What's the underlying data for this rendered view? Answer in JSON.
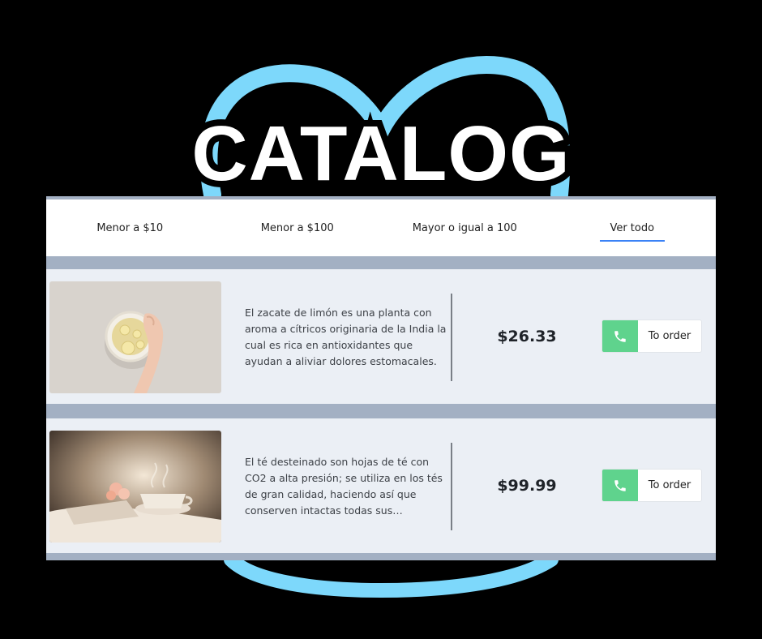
{
  "banner": {
    "title": "CATALOG"
  },
  "filters": [
    {
      "label": "Menor a $10",
      "active": false
    },
    {
      "label": "Menor a $100",
      "active": false
    },
    {
      "label": "Mayor o igual a 100",
      "active": false
    },
    {
      "label": "Ver todo",
      "active": true
    }
  ],
  "products": [
    {
      "image": "lemon-tea-photo",
      "description": "El zacate de limón es una planta con aroma a cítricos originaria de la India la cual es rica en antioxidantes que ayudan a aliviar dolores estomacales.",
      "price": "$26.33",
      "order_label": "To order",
      "order_icon": "phone-icon"
    },
    {
      "image": "tea-cup-photo",
      "description": "El té desteinado son hojas de té con CO2 a alta presión; se utiliza en los tés de gran calidad, haciendo así que conserven intactas todas sus propiedades, aroma y sabor.",
      "price": "$99.99",
      "order_label": "To order",
      "order_icon": "phone-icon"
    }
  ],
  "colors": {
    "accent": "#3b82f6",
    "order_icon_bg": "#5fd38d",
    "halo": "#7dd8fb",
    "panel_border": "#a3b0c3",
    "card_bg": "#ebeff5"
  }
}
